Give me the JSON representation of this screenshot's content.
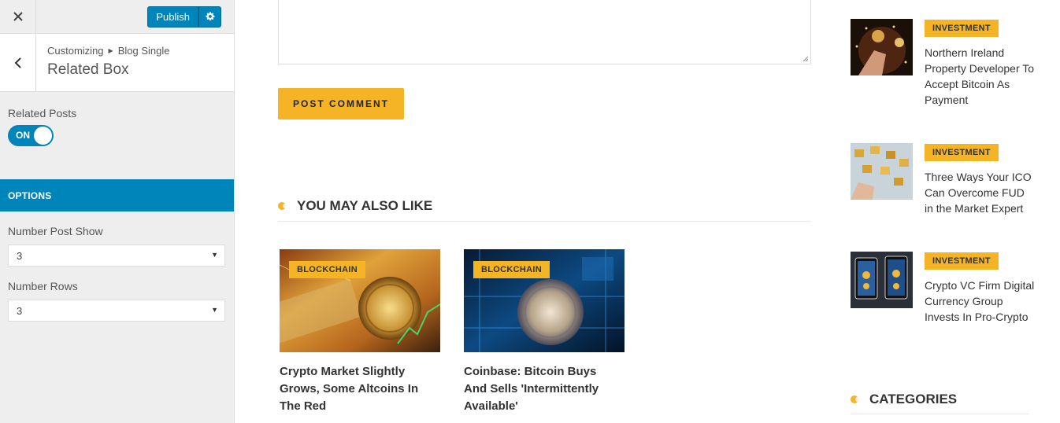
{
  "customizer": {
    "publish_label": "Publish",
    "breadcrumb": {
      "root": "Customizing",
      "section": "Blog Single"
    },
    "section_title": "Related Box",
    "related_posts": {
      "label": "Related Posts",
      "toggle_value": "ON"
    },
    "options_header": "OPTIONS",
    "number_post_show": {
      "label": "Number Post Show",
      "value": "3"
    },
    "number_rows": {
      "label": "Number Rows",
      "value": "3"
    }
  },
  "main": {
    "post_comment_label": "POST COMMENT",
    "you_may_also_like": "YOU MAY ALSO LIKE",
    "related": [
      {
        "category": "BLOCKCHAIN",
        "title": "Crypto Market Slightly Grows, Some Altcoins In The Red"
      },
      {
        "category": "BLOCKCHAIN",
        "title": "Coinbase: Bitcoin Buys And Sells 'Intermittently Available'"
      }
    ]
  },
  "right_sidebar": {
    "posts": [
      {
        "category": "INVESTMENT",
        "title": "Northern Ireland Property Developer To Accept Bitcoin As Payment"
      },
      {
        "category": "INVESTMENT",
        "title": "Three Ways Your ICO Can Overcome FUD in the Market Expert"
      },
      {
        "category": "INVESTMENT",
        "title": "Crypto VC Firm Digital Currency Group Invests In Pro-Crypto"
      }
    ],
    "categories_heading": "CATEGORIES"
  },
  "colors": {
    "accent": "#f4b425",
    "wp_blue": "#0085ba"
  }
}
